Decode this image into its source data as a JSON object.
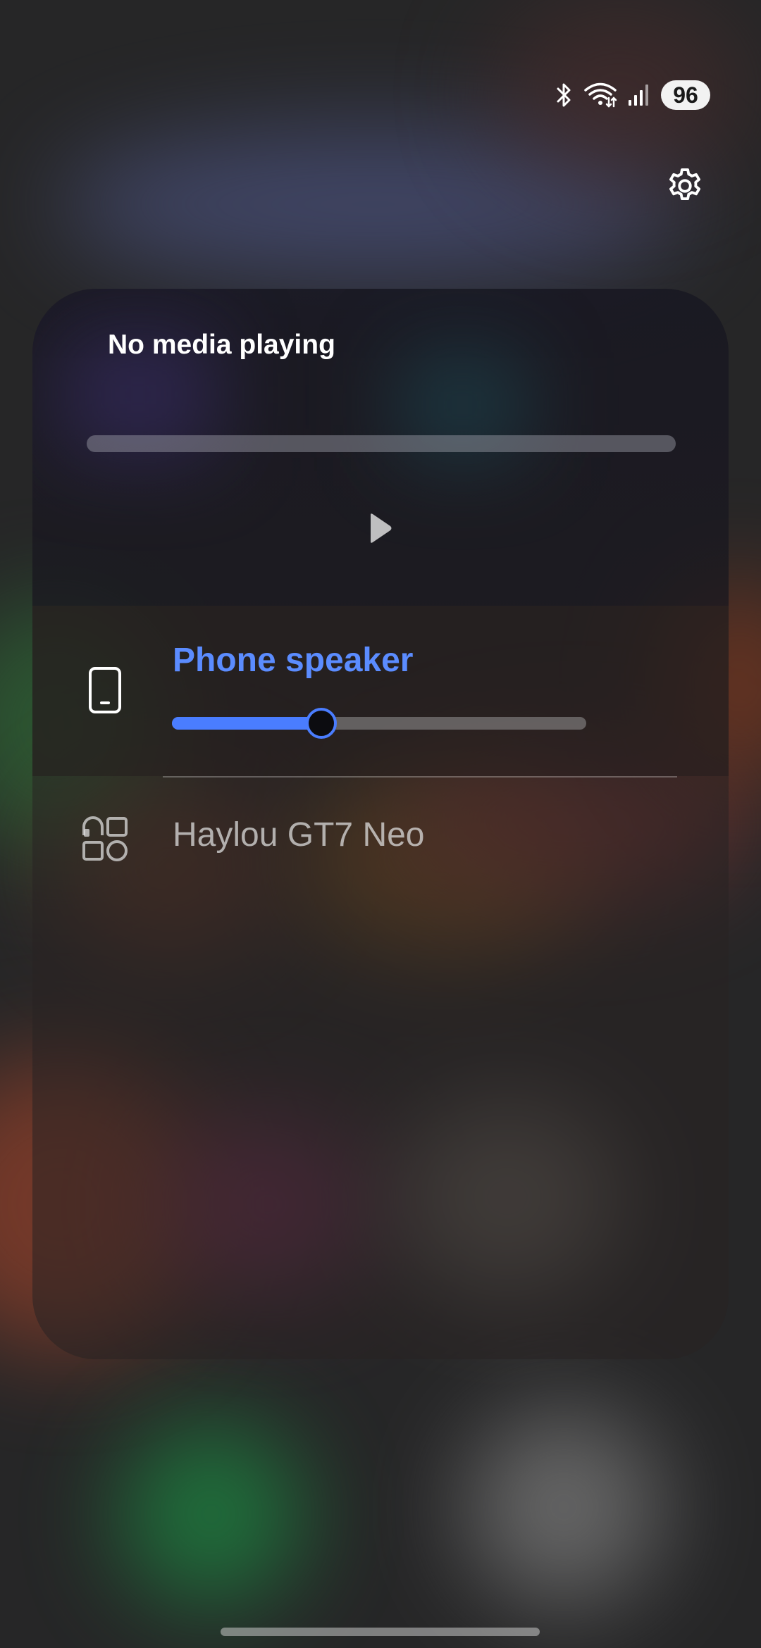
{
  "status_bar": {
    "icons": [
      "bluetooth-icon",
      "wifi-icon",
      "cellular-signal-icon"
    ],
    "battery": "96"
  },
  "header": {
    "settings_icon": "gear-icon"
  },
  "media": {
    "title": "No media playing",
    "progress": 0,
    "play_icon": "play-icon"
  },
  "devices": {
    "active": {
      "name": "Phone speaker",
      "icon": "phone-icon",
      "volume": 0.36
    },
    "others": [
      {
        "name": "Haylou GT7 Neo",
        "icon": "watch-apps-icon"
      }
    ]
  },
  "colors": {
    "accent": "#5b8cff",
    "slider": "#4a7dff"
  }
}
